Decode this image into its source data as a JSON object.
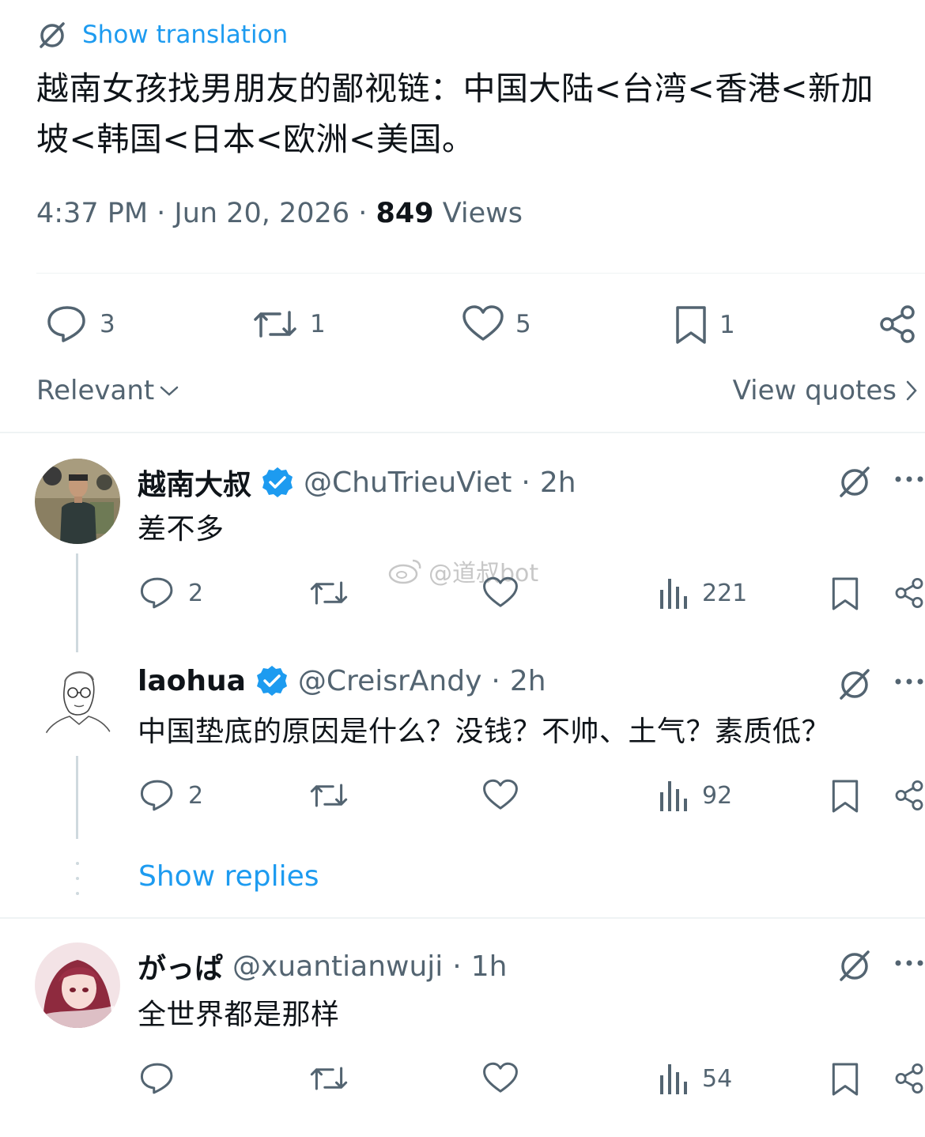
{
  "translate": {
    "label": "Show translation"
  },
  "tweet": {
    "text_line1": "越南女孩找男朋友的鄙视链：中国大陆<台湾<香港<新加",
    "text_line2": "坡<韩国<日本<欧洲<美国。",
    "time": "4:37 PM",
    "date": "Jun 20, 2026",
    "views_count": "849",
    "views_label": "Views",
    "replies": "3",
    "reposts": "1",
    "likes": "5",
    "bookmarks": "1"
  },
  "sort": {
    "label": "Relevant"
  },
  "quotes": {
    "label": "View quotes"
  },
  "replies": [
    {
      "name": "越南大叔",
      "handle": "@ChuTrieuViet",
      "time": "2h",
      "text": "差不多",
      "replies": "2",
      "views": "221"
    },
    {
      "name": "laohua",
      "handle": "@CreisrAndy",
      "time": "2h",
      "text": "中国垫底的原因是什么？没钱？不帅、土气？素质低？",
      "replies": "2",
      "views": "92"
    },
    {
      "name": "がっぱ",
      "handle": "@xuantianwuji",
      "time": "1h",
      "text": "全世界都是那样",
      "replies": "",
      "views": "54"
    }
  ],
  "show_replies": {
    "label": "Show replies"
  },
  "watermark": {
    "label": "@道叔bot"
  },
  "colors": {
    "accent": "#1d9bf0",
    "muted": "#536471",
    "text": "#0f1419",
    "verified": "#1d9bf0"
  }
}
